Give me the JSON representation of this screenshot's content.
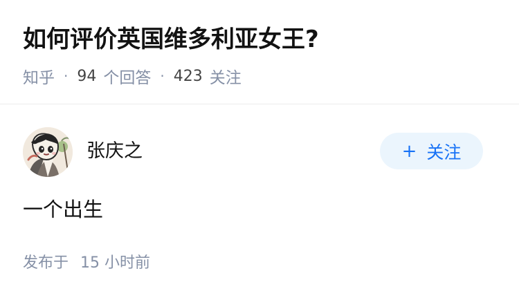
{
  "question": {
    "title": "如何评价英国维多利亚女王?",
    "source": "知乎",
    "separator": "·",
    "answer_count": "94",
    "answer_count_label": "个回答",
    "follower_count": "423",
    "follower_count_label": "关注"
  },
  "answer": {
    "author": {
      "name": "张庆之",
      "avatar_icon": "cartoon-avatar-icon"
    },
    "follow_button": {
      "icon": "plus-icon",
      "plus": "+",
      "label": "关注"
    },
    "content": "一个出生",
    "published_label": "发布于",
    "published_value": "15 小时前"
  },
  "colors": {
    "primary_text": "#121212",
    "secondary_text": "#8590a6",
    "accent": "#1772f6",
    "follow_bg": "#ebf5fd",
    "divider": "#ebebeb"
  }
}
